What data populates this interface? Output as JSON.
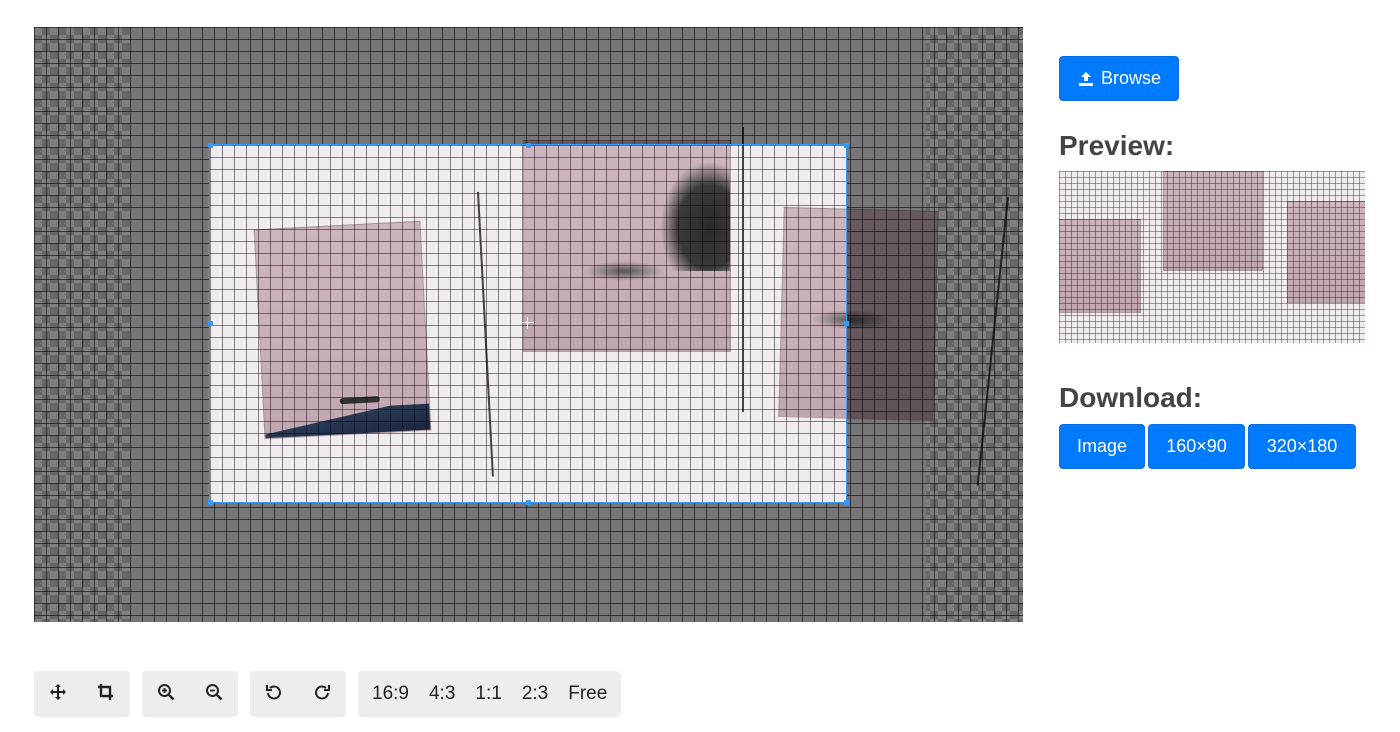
{
  "browse": {
    "label": "Browse",
    "icon": "upload-icon"
  },
  "preview": {
    "title": "Preview:"
  },
  "download": {
    "title": "Download:",
    "buttons": [
      "Image",
      "160×90",
      "320×180"
    ]
  },
  "toolbar": {
    "mode_tools": [
      {
        "icon": "move-icon",
        "name": "move"
      },
      {
        "icon": "crop-icon",
        "name": "crop"
      }
    ],
    "zoom_tools": [
      {
        "icon": "zoom-in-icon",
        "name": "zoom-in"
      },
      {
        "icon": "zoom-out-icon",
        "name": "zoom-out"
      }
    ],
    "rotate_tools": [
      {
        "icon": "rotate-left-icon",
        "name": "rotate-left"
      },
      {
        "icon": "rotate-right-icon",
        "name": "rotate-right"
      }
    ],
    "aspect_ratios": [
      "16:9",
      "4:3",
      "1:1",
      "2:3",
      "Free"
    ]
  },
  "colors": {
    "primary": "#007bff",
    "crop_outline": "#3399ff",
    "toolbar_bg": "#ededed"
  }
}
